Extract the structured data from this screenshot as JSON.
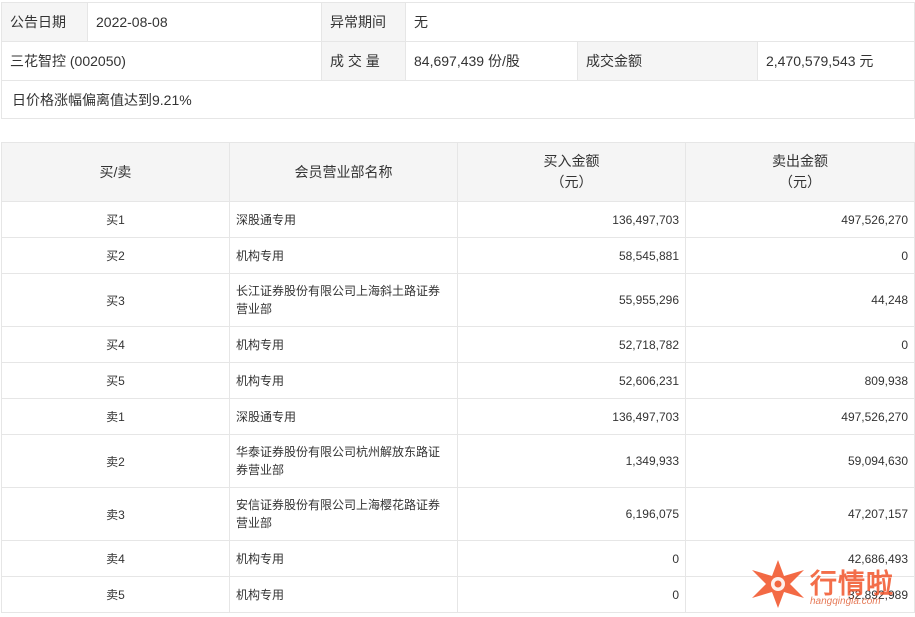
{
  "summary": {
    "date_label": "公告日期",
    "date_value": "2022-08-08",
    "period_label": "异常期间",
    "period_value": "无",
    "stock": "三花智控 (002050)",
    "volume_label": "成 交 量",
    "volume_value": "84,697,439 份/股",
    "amount_label": "成交金额",
    "amount_value": "2,470,579,543 元",
    "note": "日价格涨幅偏离值达到9.21%"
  },
  "table": {
    "headers": {
      "side": "买/卖",
      "name": "会员营业部名称",
      "buy_line1": "买入金额",
      "buy_line2": "（元）",
      "sell_line1": "卖出金额",
      "sell_line2": "（元）"
    },
    "rows": [
      {
        "side": "买1",
        "name": "深股通专用",
        "buy": "136,497,703",
        "sell": "497,526,270"
      },
      {
        "side": "买2",
        "name": "机构专用",
        "buy": "58,545,881",
        "sell": "0"
      },
      {
        "side": "买3",
        "name": "长江证券股份有限公司上海斜土路证券营业部",
        "buy": "55,955,296",
        "sell": "44,248"
      },
      {
        "side": "买4",
        "name": "机构专用",
        "buy": "52,718,782",
        "sell": "0"
      },
      {
        "side": "买5",
        "name": "机构专用",
        "buy": "52,606,231",
        "sell": "809,938"
      },
      {
        "side": "卖1",
        "name": "深股通专用",
        "buy": "136,497,703",
        "sell": "497,526,270"
      },
      {
        "side": "卖2",
        "name": "华泰证券股份有限公司杭州解放东路证券营业部",
        "buy": "1,349,933",
        "sell": "59,094,630"
      },
      {
        "side": "卖3",
        "name": "安信证券股份有限公司上海樱花路证券营业部",
        "buy": "6,196,075",
        "sell": "47,207,157"
      },
      {
        "side": "卖4",
        "name": "机构专用",
        "buy": "0",
        "sell": "42,686,493"
      },
      {
        "side": "卖5",
        "name": "机构专用",
        "buy": "0",
        "sell": "32,892,989"
      }
    ]
  },
  "watermark": {
    "logo_icon": "star-burst-logo-icon",
    "text": "行情啦",
    "url": "hangqingla.com",
    "color": "#f1552b"
  }
}
